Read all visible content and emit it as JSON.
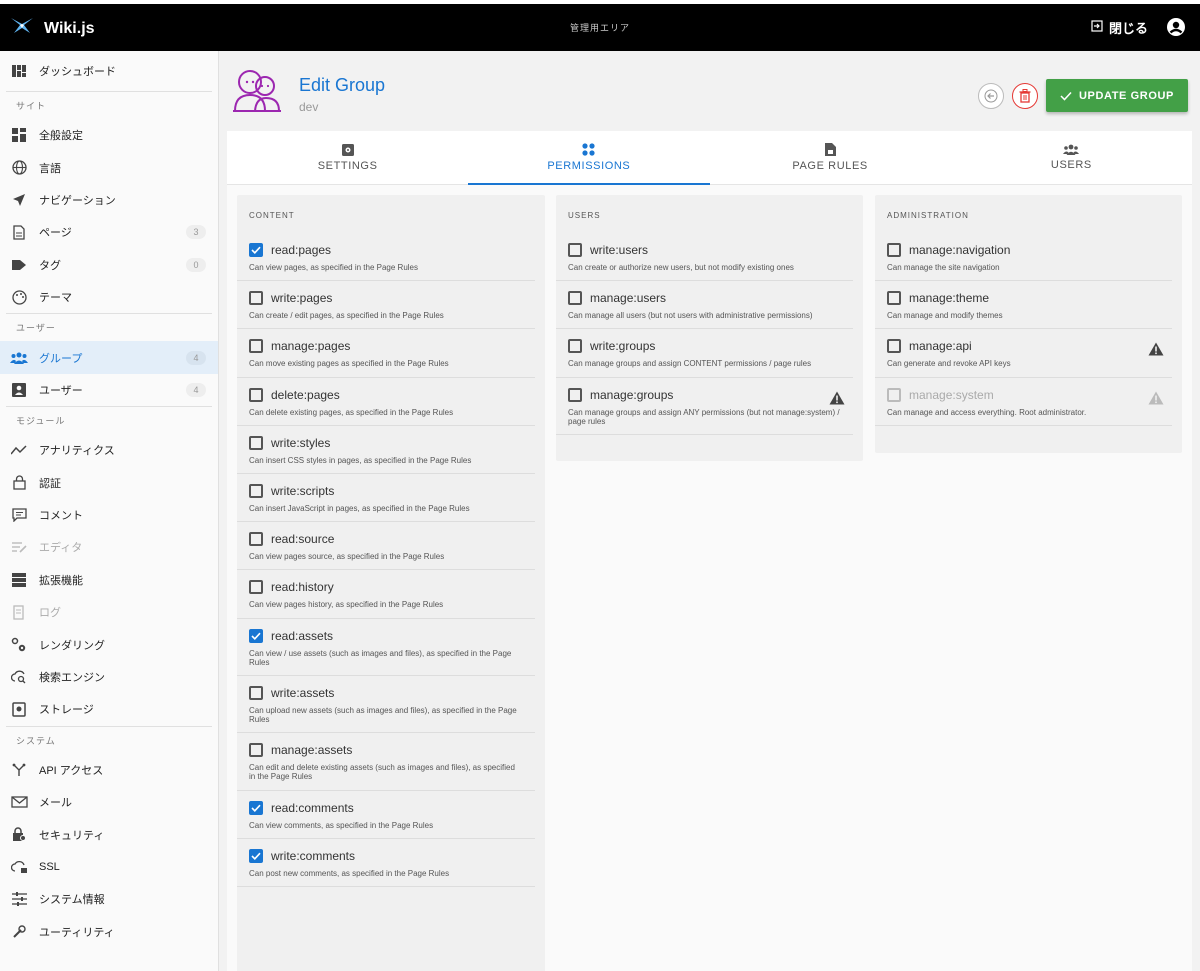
{
  "topbar": {
    "app_title": "Wiki.js",
    "center_title": "管理用エリア",
    "close_label": "閉じる"
  },
  "sidebar": {
    "dashboard": "ダッシュボード",
    "sections": {
      "site": "サイト",
      "users": "ユーザー",
      "modules": "モジュール",
      "system": "システム"
    },
    "items": {
      "general": "全般設定",
      "locale": "言語",
      "navigation": "ナビゲーション",
      "pages": "ページ",
      "pages_count": "3",
      "tags": "タグ",
      "tags_count": "0",
      "theme": "テーマ",
      "groups": "グループ",
      "groups_count": "4",
      "users": "ユーザー",
      "users_count": "4",
      "analytics": "アナリティクス",
      "auth": "認証",
      "comments": "コメント",
      "editor": "エディタ",
      "extensions": "拡張機能",
      "logging": "ログ",
      "rendering": "レンダリング",
      "search": "検索エンジン",
      "storage": "ストレージ",
      "api": "API アクセス",
      "mail": "メール",
      "security": "セキュリティ",
      "ssl": "SSL",
      "system_info": "システム情報",
      "utilities": "ユーティリティ"
    }
  },
  "header": {
    "title": "Edit Group",
    "subtitle": "dev",
    "update_button": "UPDATE GROUP"
  },
  "tabs": {
    "settings": "SETTINGS",
    "permissions": "PERMISSIONS",
    "page_rules": "PAGE RULES",
    "users": "USERS"
  },
  "colors": {
    "accent": "#1976d2",
    "success": "#43a047",
    "danger": "#e53935"
  },
  "panels": {
    "content": {
      "title": "CONTENT",
      "perms": [
        {
          "name": "read:pages",
          "desc": "Can view pages, as specified in the Page Rules",
          "checked": true
        },
        {
          "name": "write:pages",
          "desc": "Can create / edit pages, as specified in the Page Rules",
          "checked": false
        },
        {
          "name": "manage:pages",
          "desc": "Can move existing pages as specified in the Page Rules",
          "checked": false
        },
        {
          "name": "delete:pages",
          "desc": "Can delete existing pages, as specified in the Page Rules",
          "checked": false
        },
        {
          "name": "write:styles",
          "desc": "Can insert CSS styles in pages, as specified in the Page Rules",
          "checked": false
        },
        {
          "name": "write:scripts",
          "desc": "Can insert JavaScript in pages, as specified in the Page Rules",
          "checked": false
        },
        {
          "name": "read:source",
          "desc": "Can view pages source, as specified in the Page Rules",
          "checked": false
        },
        {
          "name": "read:history",
          "desc": "Can view pages history, as specified in the Page Rules",
          "checked": false
        },
        {
          "name": "read:assets",
          "desc": "Can view / use assets (such as images and files), as specified in the Page Rules",
          "checked": true
        },
        {
          "name": "write:assets",
          "desc": "Can upload new assets (such as images and files), as specified in the Page Rules",
          "checked": false
        },
        {
          "name": "manage:assets",
          "desc": "Can edit and delete existing assets (such as images and files), as specified in the Page Rules",
          "checked": false
        },
        {
          "name": "read:comments",
          "desc": "Can view comments, as specified in the Page Rules",
          "checked": true
        },
        {
          "name": "write:comments",
          "desc": "Can post new comments, as specified in the Page Rules",
          "checked": true
        }
      ]
    },
    "users": {
      "title": "USERS",
      "perms": [
        {
          "name": "write:users",
          "desc": "Can create or authorize new users, but not modify existing ones",
          "checked": false
        },
        {
          "name": "manage:users",
          "desc": "Can manage all users (but not users with administrative permissions)",
          "checked": false
        },
        {
          "name": "write:groups",
          "desc": "Can manage groups and assign CONTENT permissions / page rules",
          "checked": false
        },
        {
          "name": "manage:groups",
          "desc": "Can manage groups and assign ANY permissions (but not manage:system) / page rules",
          "checked": false,
          "warn": true
        }
      ]
    },
    "admin": {
      "title": "ADMINISTRATION",
      "perms": [
        {
          "name": "manage:navigation",
          "desc": "Can manage the site navigation",
          "checked": false
        },
        {
          "name": "manage:theme",
          "desc": "Can manage and modify themes",
          "checked": false
        },
        {
          "name": "manage:api",
          "desc": "Can generate and revoke API keys",
          "checked": false,
          "warn": true
        },
        {
          "name": "manage:system",
          "desc": "Can manage and access everything. Root administrator.",
          "checked": false,
          "warn": true,
          "disabled": true
        }
      ]
    }
  }
}
